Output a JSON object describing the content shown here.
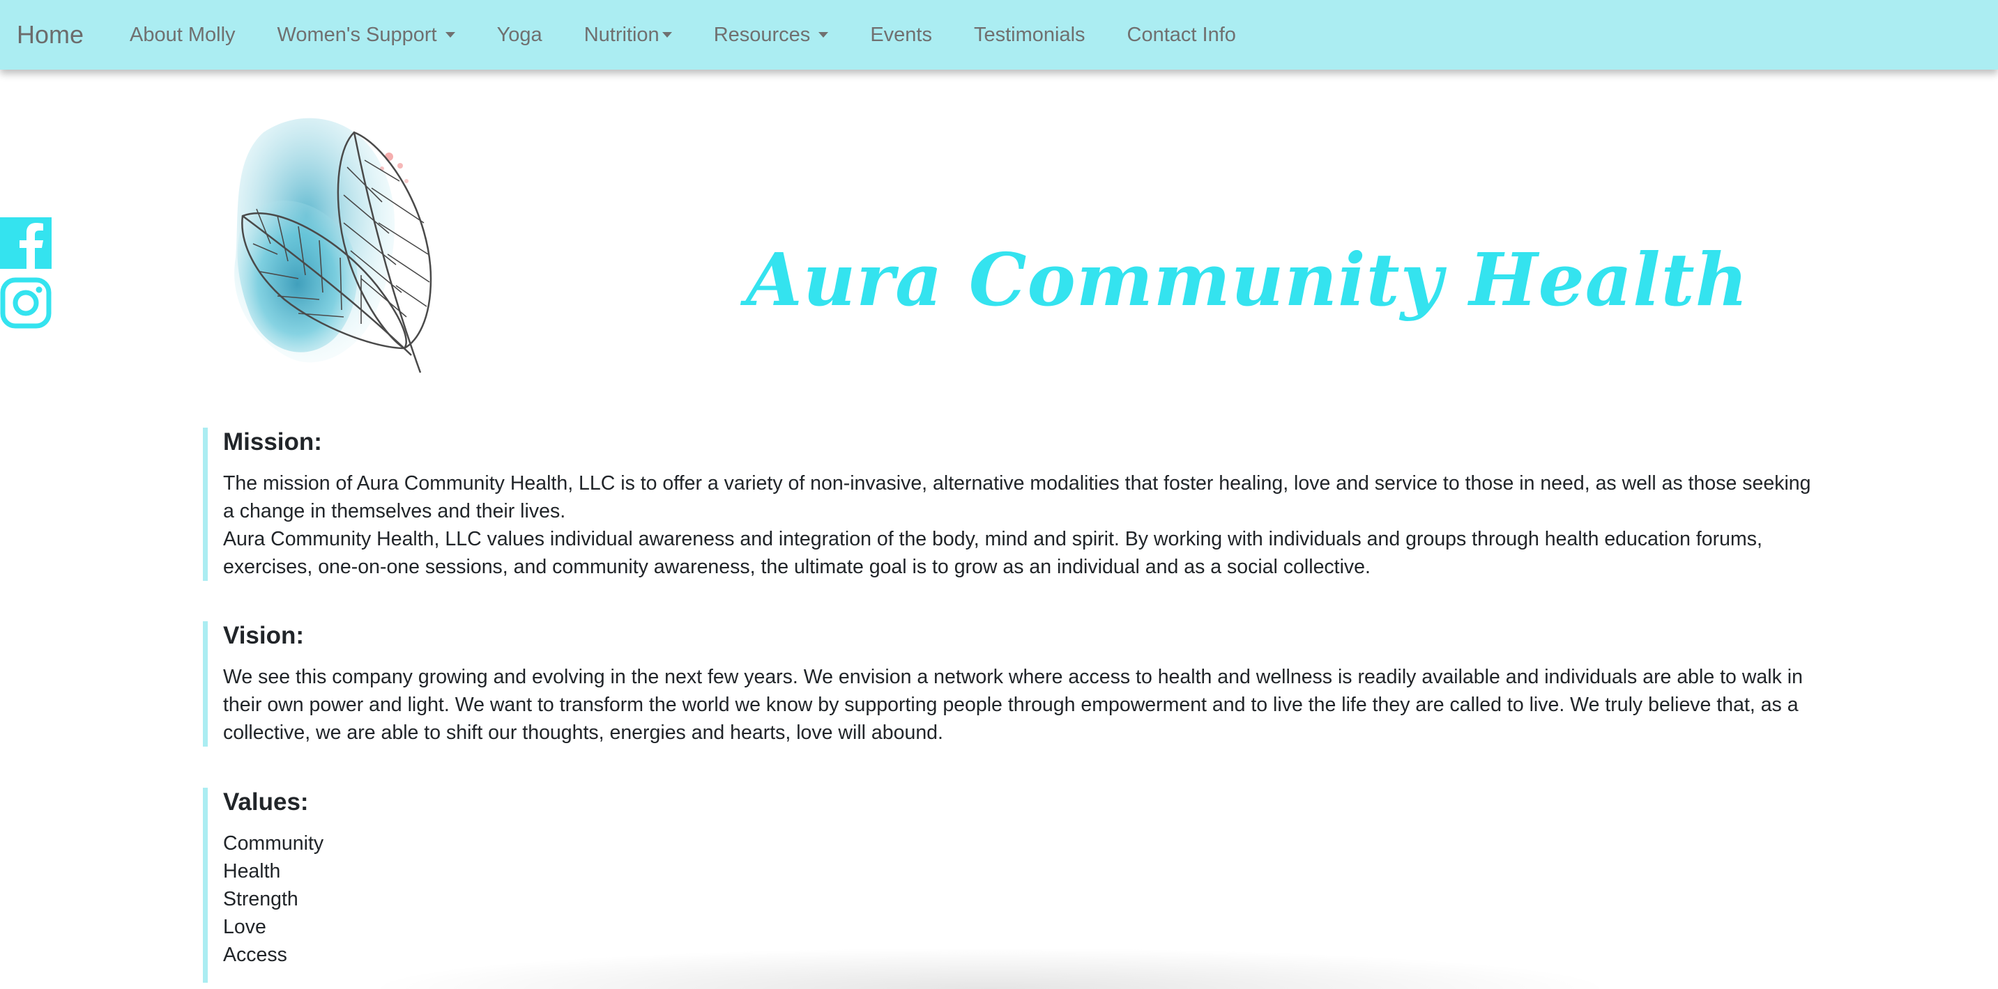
{
  "nav": {
    "brand": "Home",
    "items": [
      {
        "label": "About Molly",
        "dropdown": false
      },
      {
        "label": "Women's Support",
        "dropdown": true
      },
      {
        "label": "Yoga",
        "dropdown": false
      },
      {
        "label": "Nutrition",
        "dropdown": true
      },
      {
        "label": "Resources",
        "dropdown": true
      },
      {
        "label": "Events",
        "dropdown": false
      },
      {
        "label": "Testimonials",
        "dropdown": false
      },
      {
        "label": "Contact Info",
        "dropdown": false
      }
    ]
  },
  "social": {
    "icons": [
      "facebook-icon",
      "instagram-icon"
    ]
  },
  "hero": {
    "title": "Aura Community Health",
    "logo_icon": "feather-watercolor-logo"
  },
  "mission": {
    "heading": "Mission:",
    "paragraphs": [
      "The mission of Aura Community Health, LLC is to offer a variety of non-invasive, alternative modalities that foster healing, love and service to those in need, as well as those seeking a change in themselves and their lives.",
      "Aura Community Health, LLC values individual awareness and integration of the body, mind and spirit. By working with individuals and groups through health education forums, exercises, one-on-one sessions, and community awareness, the ultimate goal is to grow as an individual and as a social collective."
    ]
  },
  "vision": {
    "heading": "Vision:",
    "text": "We see this company growing and evolving in the next few years. We envision a network where access to health and wellness is readily available and individuals are able to walk in their own power and light. We want to transform the world we know by supporting people through empowerment and to live the life they are called to live. We truly believe that, as a collective, we are able to shift our thoughts, energies and hearts, love will abound."
  },
  "values": {
    "heading": "Values:",
    "items": [
      "Community",
      "Health",
      "Strength",
      "Love",
      "Access"
    ]
  },
  "colors": {
    "navbar_bg": "#abedf2",
    "accent": "#34e3ef",
    "nav_text": "#707070"
  }
}
